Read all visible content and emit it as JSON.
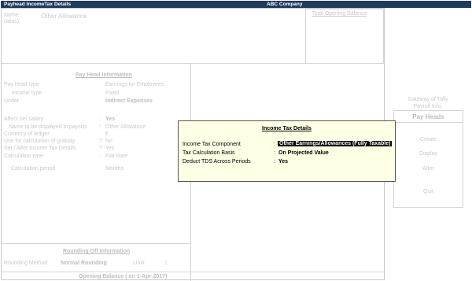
{
  "titlebar": {
    "screen_title": "Payhead IncomeTax Details",
    "company": "ABC Company"
  },
  "header": {
    "name_label": "Name",
    "alias_label": "(alias)",
    "name_value": "Other Allowance",
    "total_opening_balance": "Total Opening Balance"
  },
  "pay_head_info": {
    "heading": "Pay Head Information",
    "rows": [
      {
        "label": "Pay head type",
        "value": "Earnings for Employees"
      },
      {
        "label": "Income type",
        "value": "Fixed"
      },
      {
        "label": "Under",
        "value": "Indirect Expenses"
      }
    ],
    "rows2": [
      {
        "label": "Affect net salary",
        "value": "Yes"
      },
      {
        "label": "Name to be displayed in payslip",
        "value": "Other Allowance"
      },
      {
        "label": "Currency of ledger",
        "value": "€"
      },
      {
        "label": "Use for calculation of gratuity",
        "value": "No"
      },
      {
        "label": "Set / Alter Income Tax Details",
        "value": "Yes"
      },
      {
        "label": "Calculation type",
        "value": "Flat Rate"
      }
    ],
    "calc_period_label": "Calculation period",
    "calc_period_value": "Months"
  },
  "rounding": {
    "heading": "Rounding Off Information",
    "method_label": "Rounding Method",
    "method_value": "Normal Rounding",
    "limit_label": "Limit",
    "limit_value": "1"
  },
  "opening_balance": "Opening Balance  ( on 1-Apr-2017)",
  "gateway": {
    "line1": "Gateway of Tally",
    "line2": "Payroll Info."
  },
  "buttons": {
    "heading": "Pay Heads",
    "create": "Create",
    "display": "Display",
    "alter": "Alter",
    "quit": "Quit"
  },
  "dialog": {
    "title": "Income Tax Details",
    "fields": [
      {
        "label": "Income Tax Component",
        "value": "Other Earnings/Allowances (Fully Taxable)"
      },
      {
        "label": "Tax Calculation Basis",
        "value": "On Projected Value"
      },
      {
        "label": "Deduct TDS Across Periods",
        "value": "Yes"
      }
    ]
  }
}
